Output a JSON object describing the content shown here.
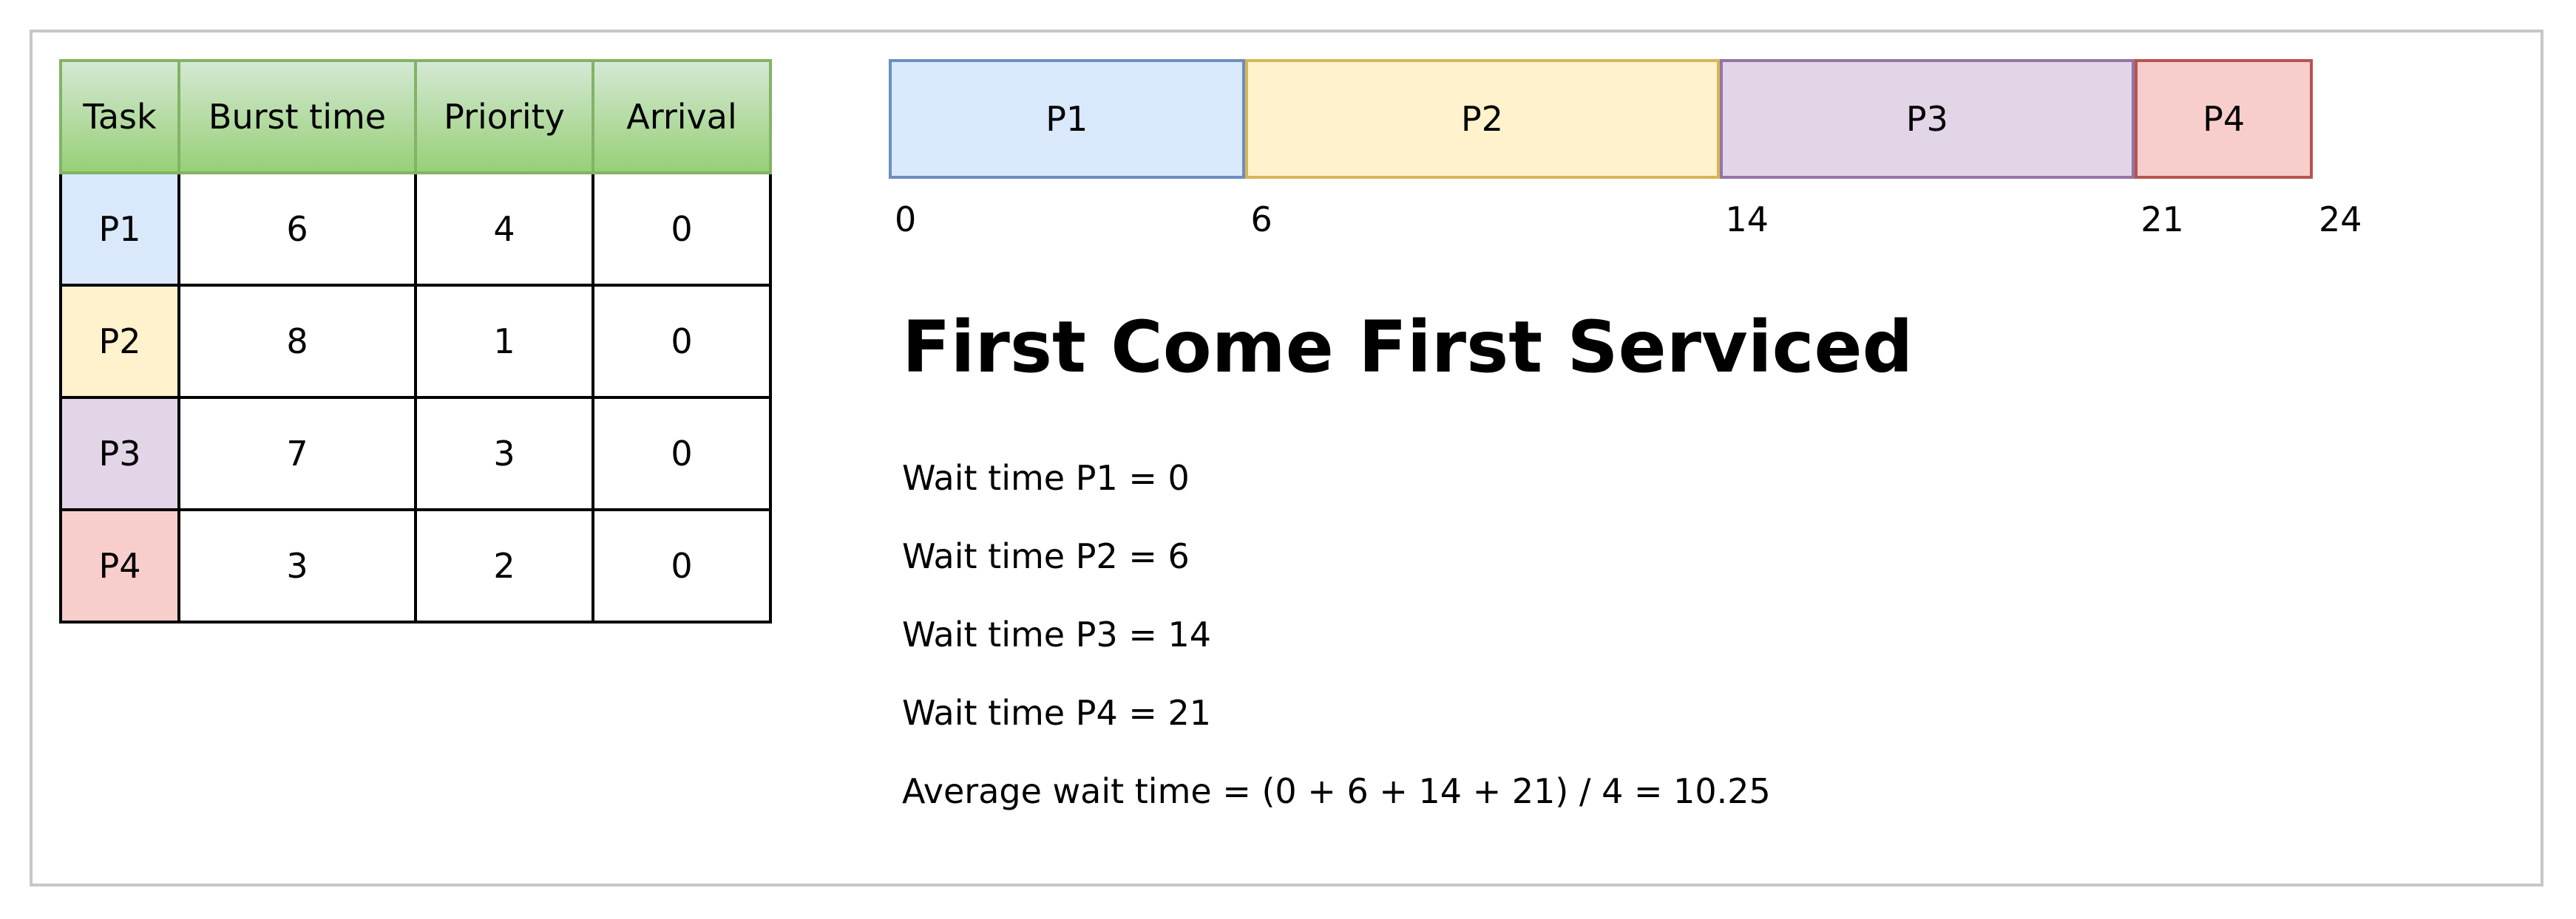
{
  "table": {
    "headers": [
      "Task",
      "Burst time",
      "Priority",
      "Arrival"
    ],
    "rows": [
      {
        "task": "P1",
        "burst": "6",
        "priority": "4",
        "arrival": "0",
        "color": "#dae8fc"
      },
      {
        "task": "P2",
        "burst": "8",
        "priority": "1",
        "arrival": "0",
        "color": "#fff2cc"
      },
      {
        "task": "P3",
        "burst": "7",
        "priority": "3",
        "arrival": "0",
        "color": "#e1d5e7"
      },
      {
        "task": "P4",
        "burst": "3",
        "priority": "2",
        "arrival": "0",
        "color": "#f8cecc"
      }
    ],
    "header_gradient": [
      "#d5e8d4",
      "#97d077"
    ]
  },
  "gantt": {
    "time_max": 24,
    "blocks": [
      {
        "label": "P1",
        "start": 0,
        "end": 6,
        "fill": "#dae8fc",
        "stroke": "#6c8ebf"
      },
      {
        "label": "P2",
        "start": 6,
        "end": 14,
        "fill": "#fff2cc",
        "stroke": "#d6b656"
      },
      {
        "label": "P3",
        "start": 14,
        "end": 21,
        "fill": "#e1d5e7",
        "stroke": "#9673a6"
      },
      {
        "label": "P4",
        "start": 21,
        "end": 24,
        "fill": "#f8cecc",
        "stroke": "#b85450"
      }
    ],
    "ticks": [
      "0",
      "6",
      "14",
      "21",
      "24"
    ]
  },
  "title": "First Come First Serviced",
  "wait_times": [
    "Wait time P1 = 0",
    "Wait time P2 = 6",
    "Wait time P3 = 14",
    "Wait time P4 = 21"
  ],
  "average": "Average wait time = (0 + 6 + 14 + 21) / 4 = 10.25"
}
